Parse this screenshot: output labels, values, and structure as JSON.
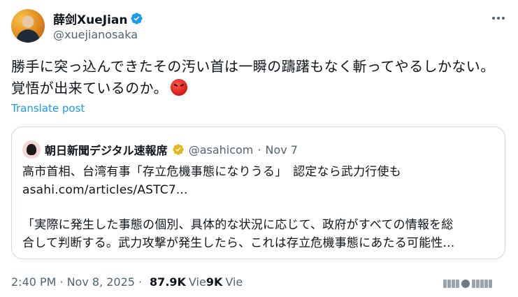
{
  "author": {
    "display_name": "薛剑XueJian",
    "handle": "@xuejianosaka"
  },
  "post": {
    "text": "勝手に突っ込んできたその汚い首は一瞬の躊躇もなく斬ってやるしかない。覚悟が出来ているのか。",
    "emoji": "angry-face-icon",
    "translate_label": "Translate post"
  },
  "quote": {
    "display_name": "朝日新聞デジタル速報席",
    "handle": "@asahicom",
    "separator": "·",
    "date": "Nov 7",
    "line1": "高市首相、台湾有事「存立危機事態になりうる」　認定なら武力行使も",
    "line2": "asahi.com/articles/ASTC7...",
    "line3": "「実際に発生した事態の個別、具体的な状況に応じて、政府がすべての情報を総",
    "line4": "合して判断する。武力攻撃が発生したら、これは存立危機事態にあたる可能性..."
  },
  "meta": {
    "time": "2:40 PM",
    "separator": "·",
    "date": "Nov 8, 2025",
    "views_count": "87.9K",
    "views_label_1": "Vie",
    "views_label_2": "9K",
    "views_label_3": "Vie"
  },
  "colors": {
    "link": "#1d9bf0",
    "verified_blue": "#1d9bf0",
    "verified_gold": "#e2b719",
    "secondary_text": "#536471"
  }
}
